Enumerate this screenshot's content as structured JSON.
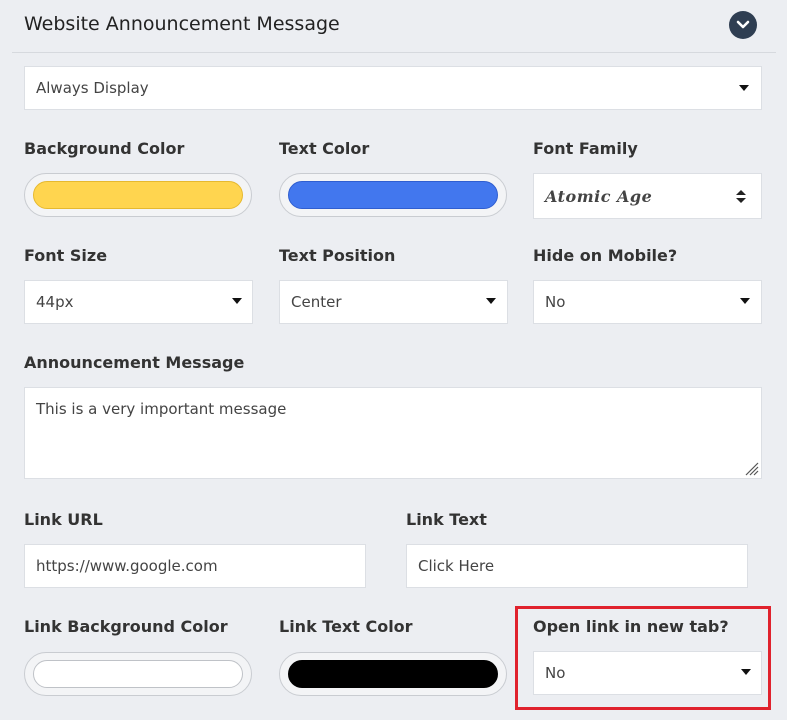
{
  "header": {
    "title": "Website Announcement Message"
  },
  "display_mode": {
    "value": "Always Display"
  },
  "background_color": {
    "label": "Background Color",
    "color": "#ffd54f"
  },
  "text_color": {
    "label": "Text Color",
    "color": "#4277ee"
  },
  "font_family": {
    "label": "Font Family",
    "value": "Atomic Age"
  },
  "font_size": {
    "label": "Font Size",
    "value": "44px"
  },
  "text_position": {
    "label": "Text Position",
    "value": "Center"
  },
  "hide_on_mobile": {
    "label": "Hide on Mobile?",
    "value": "No"
  },
  "announcement_message": {
    "label": "Announcement Message",
    "value": "This is a very important message"
  },
  "link_url": {
    "label": "Link URL",
    "value": "https://www.google.com"
  },
  "link_text": {
    "label": "Link Text",
    "value": "Click Here"
  },
  "link_background_color": {
    "label": "Link Background Color",
    "color": "#ffffff"
  },
  "link_text_color": {
    "label": "Link Text Color",
    "color": "#000000"
  },
  "open_new_tab": {
    "label": "Open link in new tab?",
    "value": "No"
  },
  "colors": {
    "highlight": "#e0222d",
    "header_button": "#2f3e52",
    "page_bg": "#eceef2"
  }
}
